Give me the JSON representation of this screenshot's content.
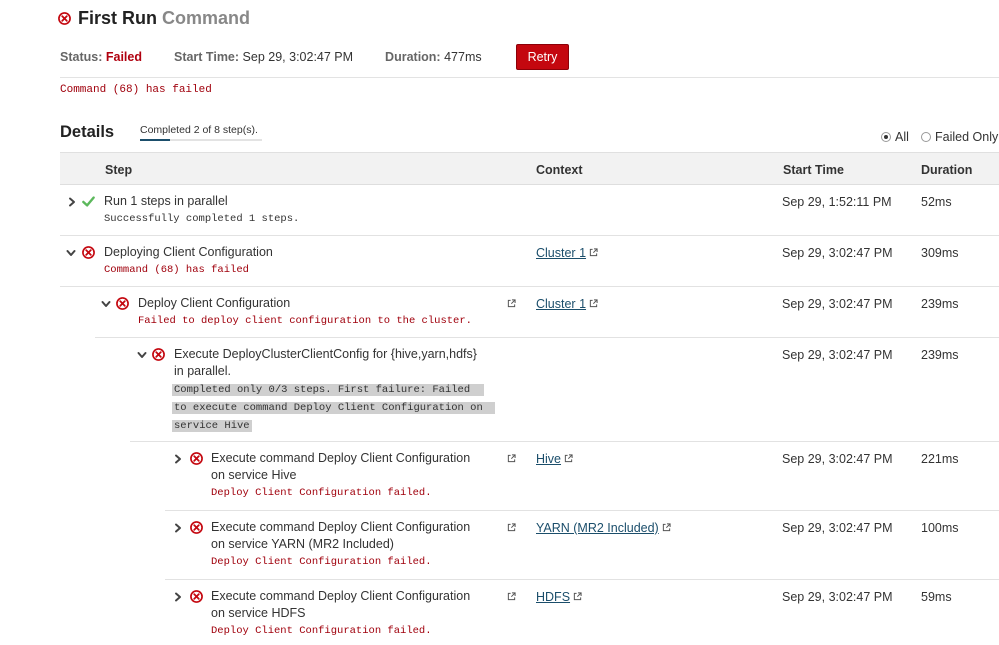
{
  "header": {
    "title": "First Run",
    "subtitle": "Command",
    "status_label": "Status:",
    "status_value": "Failed",
    "start_label": "Start Time:",
    "start_value": "Sep 29, 3:02:47 PM",
    "duration_label": "Duration:",
    "duration_value": "477ms",
    "retry_label": "Retry",
    "failure_message": "Command (68) has failed"
  },
  "details": {
    "title": "Details",
    "completed_label": "Completed 2 of 8 step(s).",
    "filter_all": "All",
    "filter_failed": "Failed Only"
  },
  "table": {
    "columns": [
      "Step",
      "Context",
      "Start Time",
      "Duration"
    ],
    "rows": [
      {
        "title": "Run 1 steps in parallel",
        "subtitle": "Successfully completed 1 steps.",
        "context": "",
        "start": "Sep 29, 1:52:11 PM",
        "duration": "52ms",
        "status": "success",
        "expanded": false
      },
      {
        "title": "Deploying Client Configuration",
        "subtitle": "Command (68) has failed",
        "context": "Cluster 1",
        "start": "Sep 29, 3:02:47 PM",
        "duration": "309ms",
        "status": "failed",
        "expanded": true
      },
      {
        "title": "Deploy Client Configuration",
        "subtitle": "Failed to deploy client configuration to the cluster.",
        "context": "Cluster 1",
        "start": "Sep 29, 3:02:47 PM",
        "duration": "239ms",
        "status": "failed",
        "expanded": true
      },
      {
        "title_line1": "Execute DeployClusterClientConfig for {hive,yarn,hdfs}",
        "title_line2": "in parallel.",
        "subtitle_line1": "Completed only 0/3 steps. First failure: Failed",
        "subtitle_line2": "to execute command Deploy Client Configuration on",
        "subtitle_line3": "service Hive",
        "context": "",
        "start": "Sep 29, 3:02:47 PM",
        "duration": "239ms",
        "status": "failed",
        "expanded": true
      },
      {
        "title_line1": "Execute command Deploy Client Configuration",
        "title_line2": "on service Hive",
        "subtitle": "Deploy Client Configuration failed.",
        "context": "Hive",
        "start": "Sep 29, 3:02:47 PM",
        "duration": "221ms",
        "status": "failed",
        "expanded": false
      },
      {
        "title_line1": "Execute command Deploy Client Configuration",
        "title_line2": "on service YARN (MR2 Included)",
        "subtitle": "Deploy Client Configuration failed.",
        "context": "YARN (MR2 Included)",
        "start": "Sep 29, 3:02:47 PM",
        "duration": "100ms",
        "status": "failed",
        "expanded": false
      },
      {
        "title_line1": "Execute command Deploy Client Configuration",
        "title_line2": "on service HDFS",
        "subtitle": "Deploy Client Configuration failed.",
        "context": "HDFS",
        "start": "Sep 29, 3:02:47 PM",
        "duration": "59ms",
        "status": "failed",
        "expanded": false
      }
    ]
  },
  "icons": {
    "failed": "failed-circle-x-icon",
    "success": "success-check-icon",
    "expand": "chevron-right-icon",
    "collapse": "chevron-down-icon",
    "external": "external-link-icon"
  },
  "colors": {
    "fail_red": "#c4070f",
    "error_text": "#a0000c",
    "success_green": "#5cb85c",
    "link_blue": "#1b4e6b",
    "header_bg": "#f2f2f2"
  }
}
